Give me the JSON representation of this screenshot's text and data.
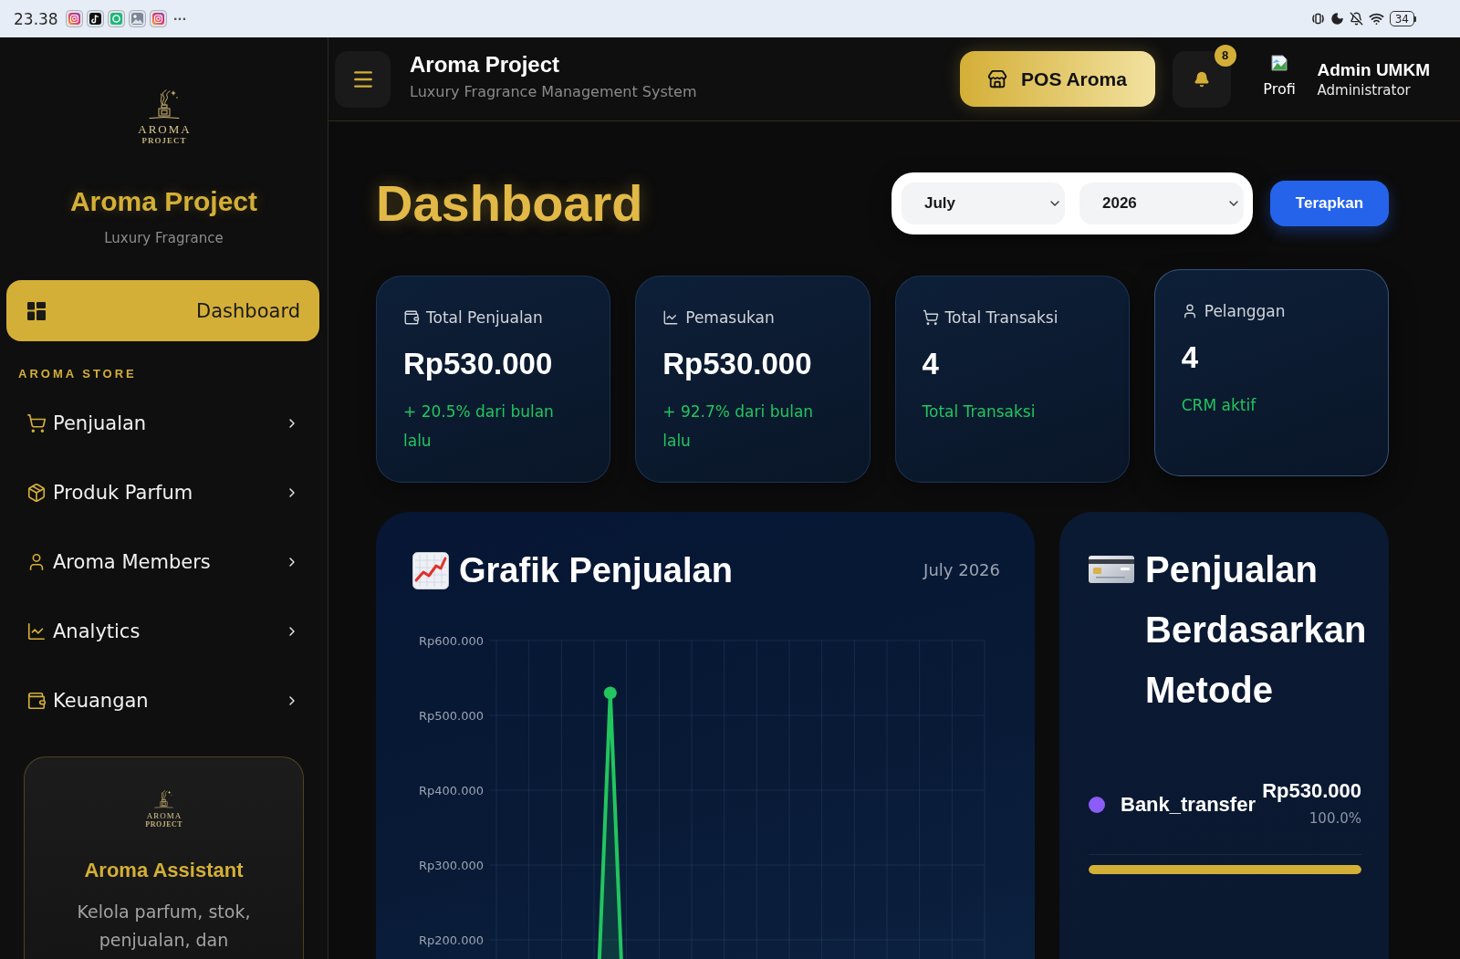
{
  "status_bar": {
    "time": "23.38",
    "more": "···",
    "battery": "34"
  },
  "sidebar": {
    "logo": {
      "wordmark": "AROMA",
      "subtitle": "PROJECT"
    },
    "brand": "Aroma Project",
    "tagline": "Luxury Fragrance",
    "nav": [
      {
        "label": "Dashboard",
        "selected": true
      }
    ],
    "section": {
      "title": "AROMA STORE",
      "items": [
        {
          "label": "Penjualan",
          "selected": false,
          "expanded": false
        },
        {
          "label": "Produk Parfum",
          "selected": false,
          "expanded": false
        },
        {
          "label": "Aroma Members",
          "selected": false,
          "expanded": false
        },
        {
          "label": "Analytics",
          "selected": false,
          "expanded": false
        },
        {
          "label": "Keuangan",
          "selected": false,
          "expanded": false
        }
      ]
    },
    "assistant": {
      "logo": {
        "wordmark": "AROMA",
        "subtitle": "PROJECT"
      },
      "title": "Aroma Assistant",
      "text": "Kelola parfum, stok, penjualan, dan"
    }
  },
  "header": {
    "title": "Aroma Project",
    "subtitle": "Luxury Fragrance Management System",
    "pos_button": "POS Aroma",
    "notification_badge": "8",
    "profile": {
      "avatar_alt": "Profi",
      "name": "Admin UMKM",
      "role": "Administrator"
    }
  },
  "page": {
    "title": "Dashboard",
    "filter": {
      "month": "July",
      "year": "2026",
      "apply_button": "Terapkan"
    }
  },
  "stats": [
    {
      "label": "Total Penjualan",
      "value": "Rp530.000",
      "note": "+ 20.5% dari bulan lalu",
      "hovered": false
    },
    {
      "label": "Pemasukan",
      "value": "Rp530.000",
      "note": "+ 92.7% dari bulan lalu",
      "hovered": false
    },
    {
      "label": "Total Transaksi",
      "value": "4",
      "note": "Total Transaksi",
      "hovered": false
    },
    {
      "label": "Pelanggan",
      "value": "4",
      "note": "CRM aktif",
      "hovered": true
    }
  ],
  "sales_chart": {
    "title": "Grafik Penjualan",
    "period": "July 2026",
    "y_axis_labels": [
      "Rp600.000",
      "Rp500.000",
      "Rp400.000",
      "Rp300.000",
      "Rp200.000"
    ]
  },
  "payment_methods": {
    "title": "Penjualan Berdasarkan Metode",
    "methods": [
      {
        "name": "Bank_transfer",
        "amount": "Rp530.000",
        "share": "100.0%",
        "color": "#8b5cf6",
        "level": 1
      }
    ]
  }
}
